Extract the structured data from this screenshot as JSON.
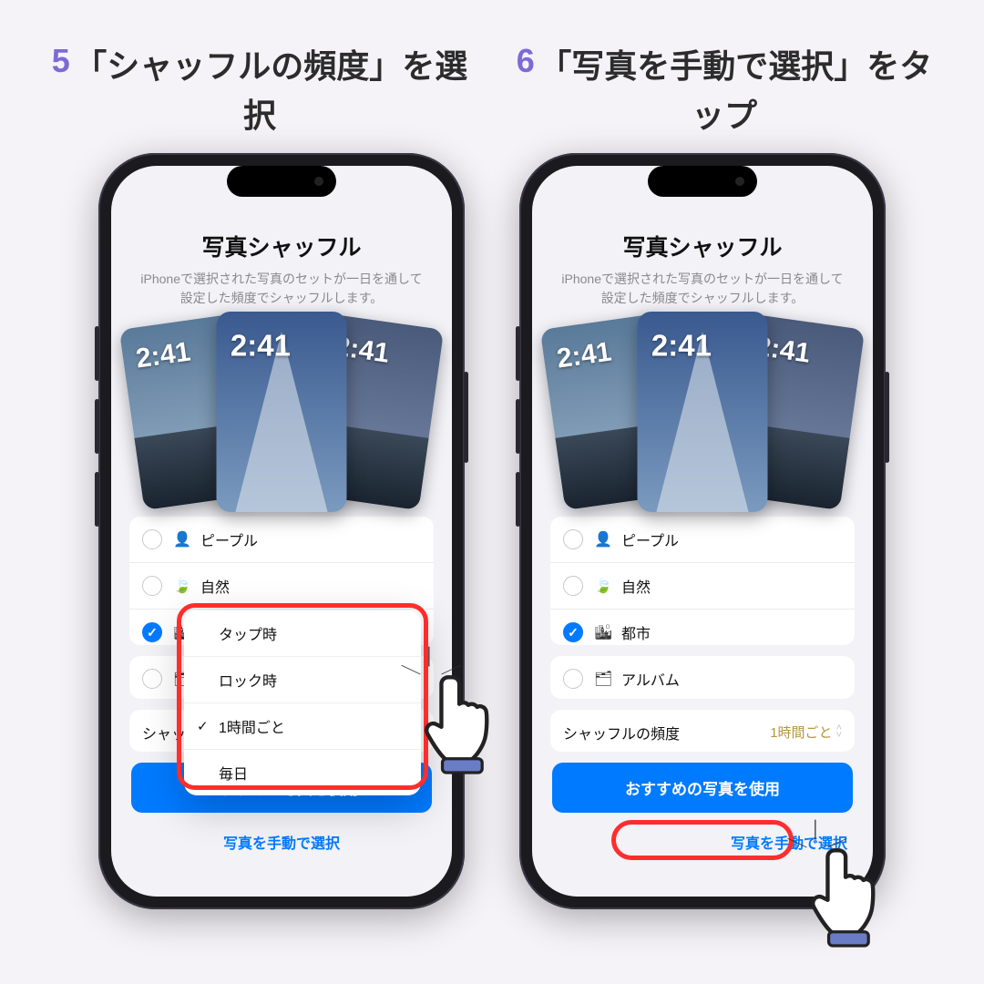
{
  "steps": [
    {
      "num": "5",
      "label": "「シャッフルの頻度」を選択"
    },
    {
      "num": "6",
      "label": "「写真を手動で選択」をタップ"
    }
  ],
  "screen": {
    "title": "写真シャッフル",
    "subtitle": "iPhoneで選択された写真のセットが一日を通して設定した頻度でシャッフルします。",
    "clock": "2:41",
    "categories": [
      {
        "label": "ピープル",
        "icon": "person",
        "checked": false
      },
      {
        "label": "自然",
        "icon": "leaf",
        "checked": false
      },
      {
        "label": "都市",
        "icon": "city",
        "checked": true
      }
    ],
    "album": {
      "label": "アルバム",
      "icon": "album",
      "checked": false
    },
    "freq_row": {
      "label": "シャッフルの頻度",
      "value": "1時間ごと"
    },
    "primary_button": "おすすめの写真を使用",
    "secondary_button": "写真を手動で選択"
  },
  "popup": {
    "options": [
      {
        "label": "タップ時",
        "checked": false
      },
      {
        "label": "ロック時",
        "checked": false
      },
      {
        "label": "1時間ごと",
        "checked": true
      },
      {
        "label": "毎日",
        "checked": false
      }
    ]
  },
  "icons": {
    "person": "👤",
    "leaf": "🍃",
    "city": "🏙",
    "album": "🗂"
  }
}
